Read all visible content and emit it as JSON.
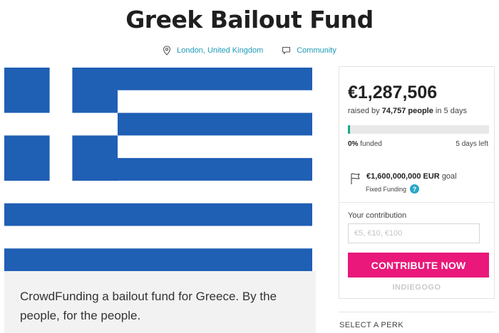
{
  "campaign": {
    "title": "Greek Bailout Fund",
    "location": "London, United Kingdom",
    "category": "Community",
    "blurb": "CrowdFunding a bailout fund for Greece. By the people, for the people."
  },
  "flag": {
    "name": "Greece",
    "colors": {
      "blue": "#1f5fb4",
      "white": "#ffffff"
    }
  },
  "funding": {
    "amount": "€1,287,506",
    "raised_prefix": "raised by",
    "people_count": "74,757 people",
    "raised_suffix": "in 5 days",
    "funded_percent": "0%",
    "funded_suffix": "funded",
    "progress_fraction": 0.016,
    "days_left": "5 days left",
    "goal_amount": "€1,600,000,000 EUR",
    "goal_suffix": "goal",
    "funding_type": "Fixed Funding"
  },
  "contribution": {
    "label": "Your contribution",
    "placeholder": "€5, €10, €100",
    "button_label": "CONTRIBUTE NOW"
  },
  "brand": "INDIEGOGO",
  "perks": {
    "label": "SELECT A PERK"
  },
  "colors": {
    "accent_link": "#1e9ab9",
    "progress": "#1aa88a",
    "cta": "#e9187a",
    "help_icon": "#2aa6c7"
  },
  "icons": {
    "location": "map-pin-icon",
    "category": "speech-bubble-icon",
    "goal": "flag-icon",
    "help": "question-icon"
  }
}
